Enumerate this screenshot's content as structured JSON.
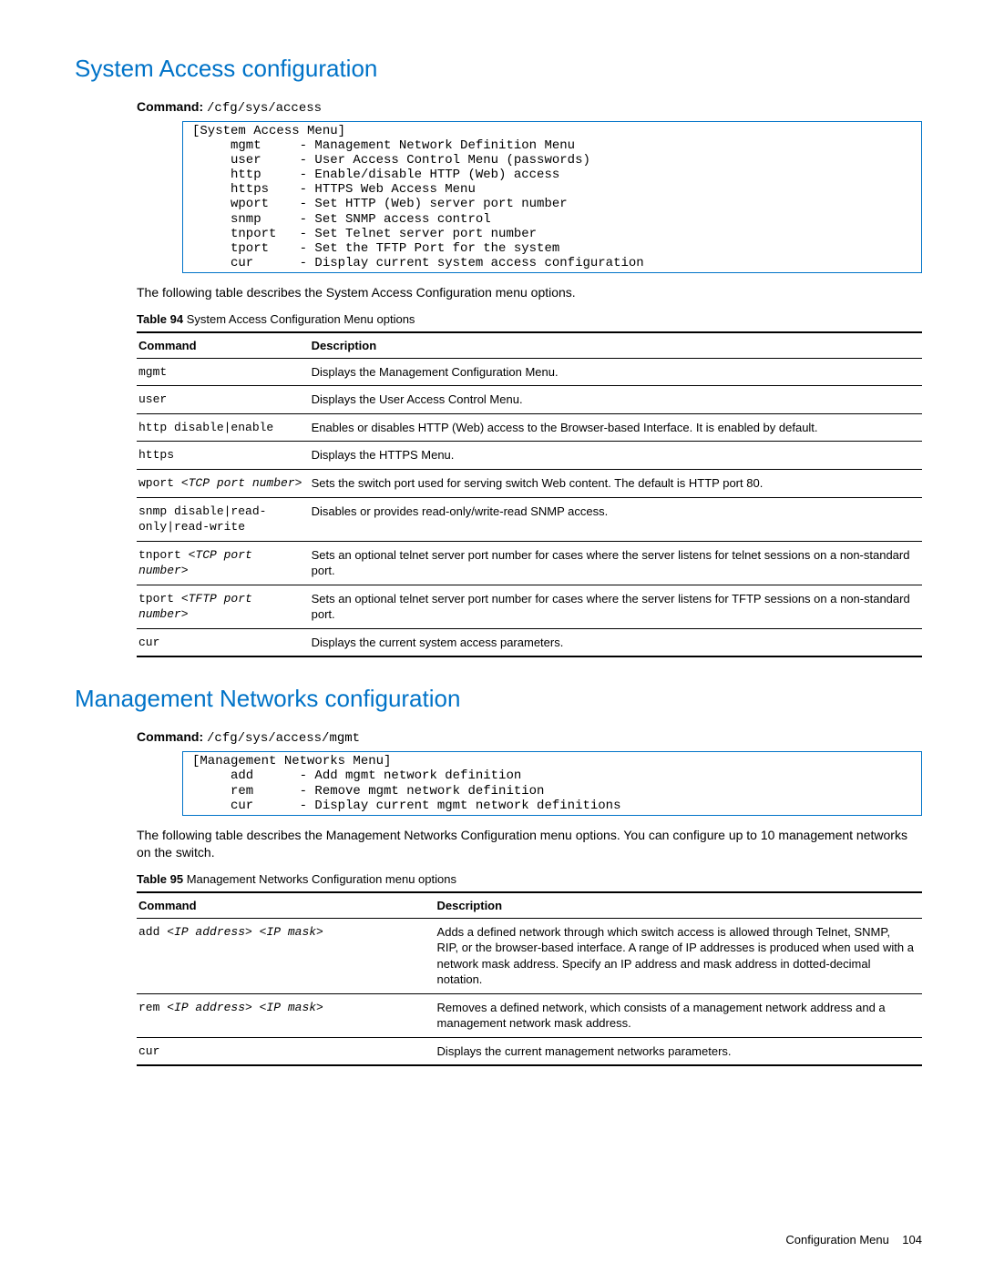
{
  "section1": {
    "heading": "System Access configuration",
    "cmd_label": "Command:",
    "cmd_path": "/cfg/sys/access",
    "code_box": "[System Access Menu]\n     mgmt     - Management Network Definition Menu\n     user     - User Access Control Menu (passwords)\n     http     - Enable/disable HTTP (Web) access\n     https    - HTTPS Web Access Menu\n     wport    - Set HTTP (Web) server port number\n     snmp     - Set SNMP access control\n     tnport   - Set Telnet server port number\n     tport    - Set the TFTP Port for the system\n     cur      - Display current system access configuration",
    "intro": "The following table describes the System Access Configuration menu options.",
    "table_label": "Table 94",
    "table_title": "System Access Configuration Menu options",
    "headers": {
      "command": "Command",
      "description": "Description"
    },
    "rows": [
      {
        "cmd": "mgmt",
        "desc": "Displays the Management Configuration Menu."
      },
      {
        "cmd": "user",
        "desc": "Displays the User Access Control Menu."
      },
      {
        "cmd": "http disable|enable",
        "desc": "Enables or disables HTTP (Web) access to the Browser-based Interface. It is enabled by default."
      },
      {
        "cmd": "https",
        "desc": "Displays the HTTPS Menu."
      },
      {
        "cmd_pre": "wport ",
        "cmd_ital": "<TCP port number>",
        "desc": "Sets the switch port used for serving switch Web content. The default is HTTP port 80."
      },
      {
        "cmd": "snmp disable|read-only|read-write",
        "desc": "Disables or provides read-only/write-read SNMP access."
      },
      {
        "cmd_pre": "tnport ",
        "cmd_ital": "<TCP port number>",
        "desc": "Sets an optional telnet server port number for cases where the server listens for telnet sessions on a non-standard port."
      },
      {
        "cmd_pre": "tport ",
        "cmd_ital": "<TFTP port number>",
        "desc": "Sets an optional telnet server port number for cases where the server listens for TFTP sessions on a non-standard port."
      },
      {
        "cmd": "cur",
        "desc": "Displays the current system access parameters."
      }
    ]
  },
  "section2": {
    "heading": "Management Networks configuration",
    "cmd_label": "Command:",
    "cmd_path": "/cfg/sys/access/mgmt",
    "code_box": "[Management Networks Menu]\n     add      - Add mgmt network definition\n     rem      - Remove mgmt network definition\n     cur      - Display current mgmt network definitions",
    "intro": "The following table describes the Management Networks Configuration menu options. You can configure up to 10 management networks on the switch.",
    "table_label": "Table 95",
    "table_title": "Management Networks Configuration menu options",
    "headers": {
      "command": "Command",
      "description": "Description"
    },
    "rows": [
      {
        "cmd_pre": "add ",
        "cmd_ital": "<IP address> <IP mask>",
        "desc": "Adds a defined network through which switch access is allowed through Telnet, SNMP, RIP, or the browser-based interface. A range of IP addresses is produced when used with a network mask address. Specify an IP address and mask address in dotted-decimal notation."
      },
      {
        "cmd_pre": "rem ",
        "cmd_ital": "<IP address> <IP mask>",
        "desc": "Removes a defined network, which consists of a management network address and a management network mask address."
      },
      {
        "cmd": "cur",
        "desc": "Displays the current management networks parameters."
      }
    ]
  },
  "footer": {
    "section": "Configuration Menu",
    "page": "104"
  }
}
